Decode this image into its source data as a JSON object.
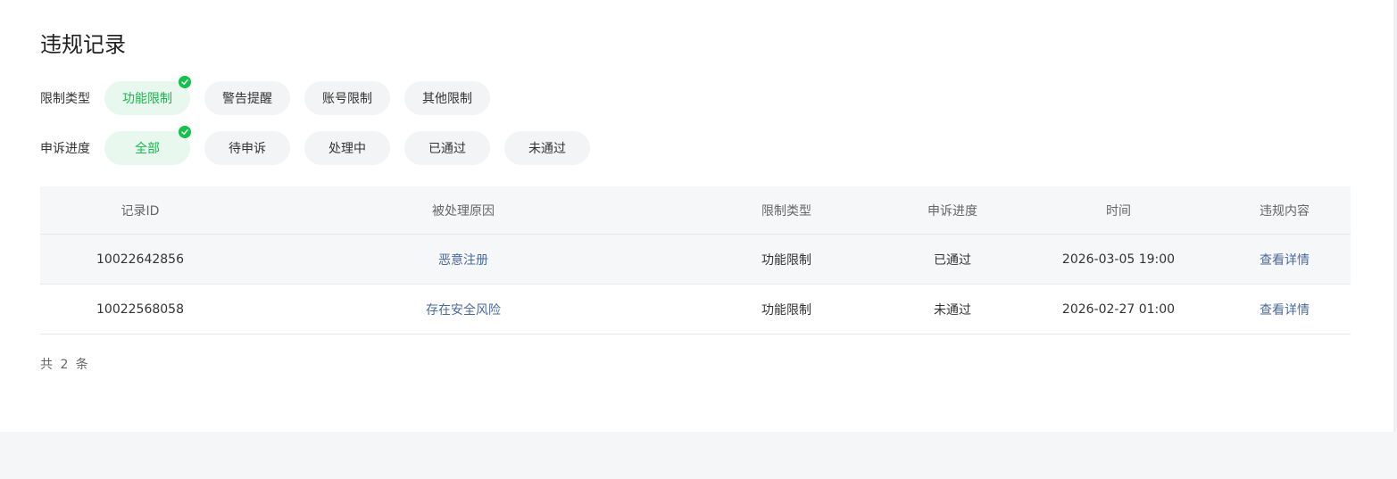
{
  "page": {
    "title": "违规记录"
  },
  "filters": {
    "restriction": {
      "label": "限制类型",
      "options": [
        "功能限制",
        "警告提醒",
        "账号限制",
        "其他限制"
      ],
      "selected": "功能限制"
    },
    "appeal": {
      "label": "申诉进度",
      "options": [
        "全部",
        "待申诉",
        "处理中",
        "已通过",
        "未通过"
      ],
      "selected": "全部"
    }
  },
  "table": {
    "columns": [
      "记录ID",
      "被处理原因",
      "限制类型",
      "申诉进度",
      "时间",
      "违规内容"
    ],
    "rows": [
      {
        "id": "10022642856",
        "reason": "恶意注册",
        "type": "功能限制",
        "status": "已通过",
        "time": "2026-03-05 19:00",
        "action": "查看详情"
      },
      {
        "id": "10022568058",
        "reason": "存在安全风险",
        "type": "功能限制",
        "status": "未通过",
        "time": "2026-02-27 01:00",
        "action": "查看详情"
      }
    ]
  },
  "footer": {
    "total": "共 2 条"
  },
  "colors": {
    "accent": "#16b94a",
    "link": "#4a6a9a",
    "background": "#f5f6f8"
  }
}
